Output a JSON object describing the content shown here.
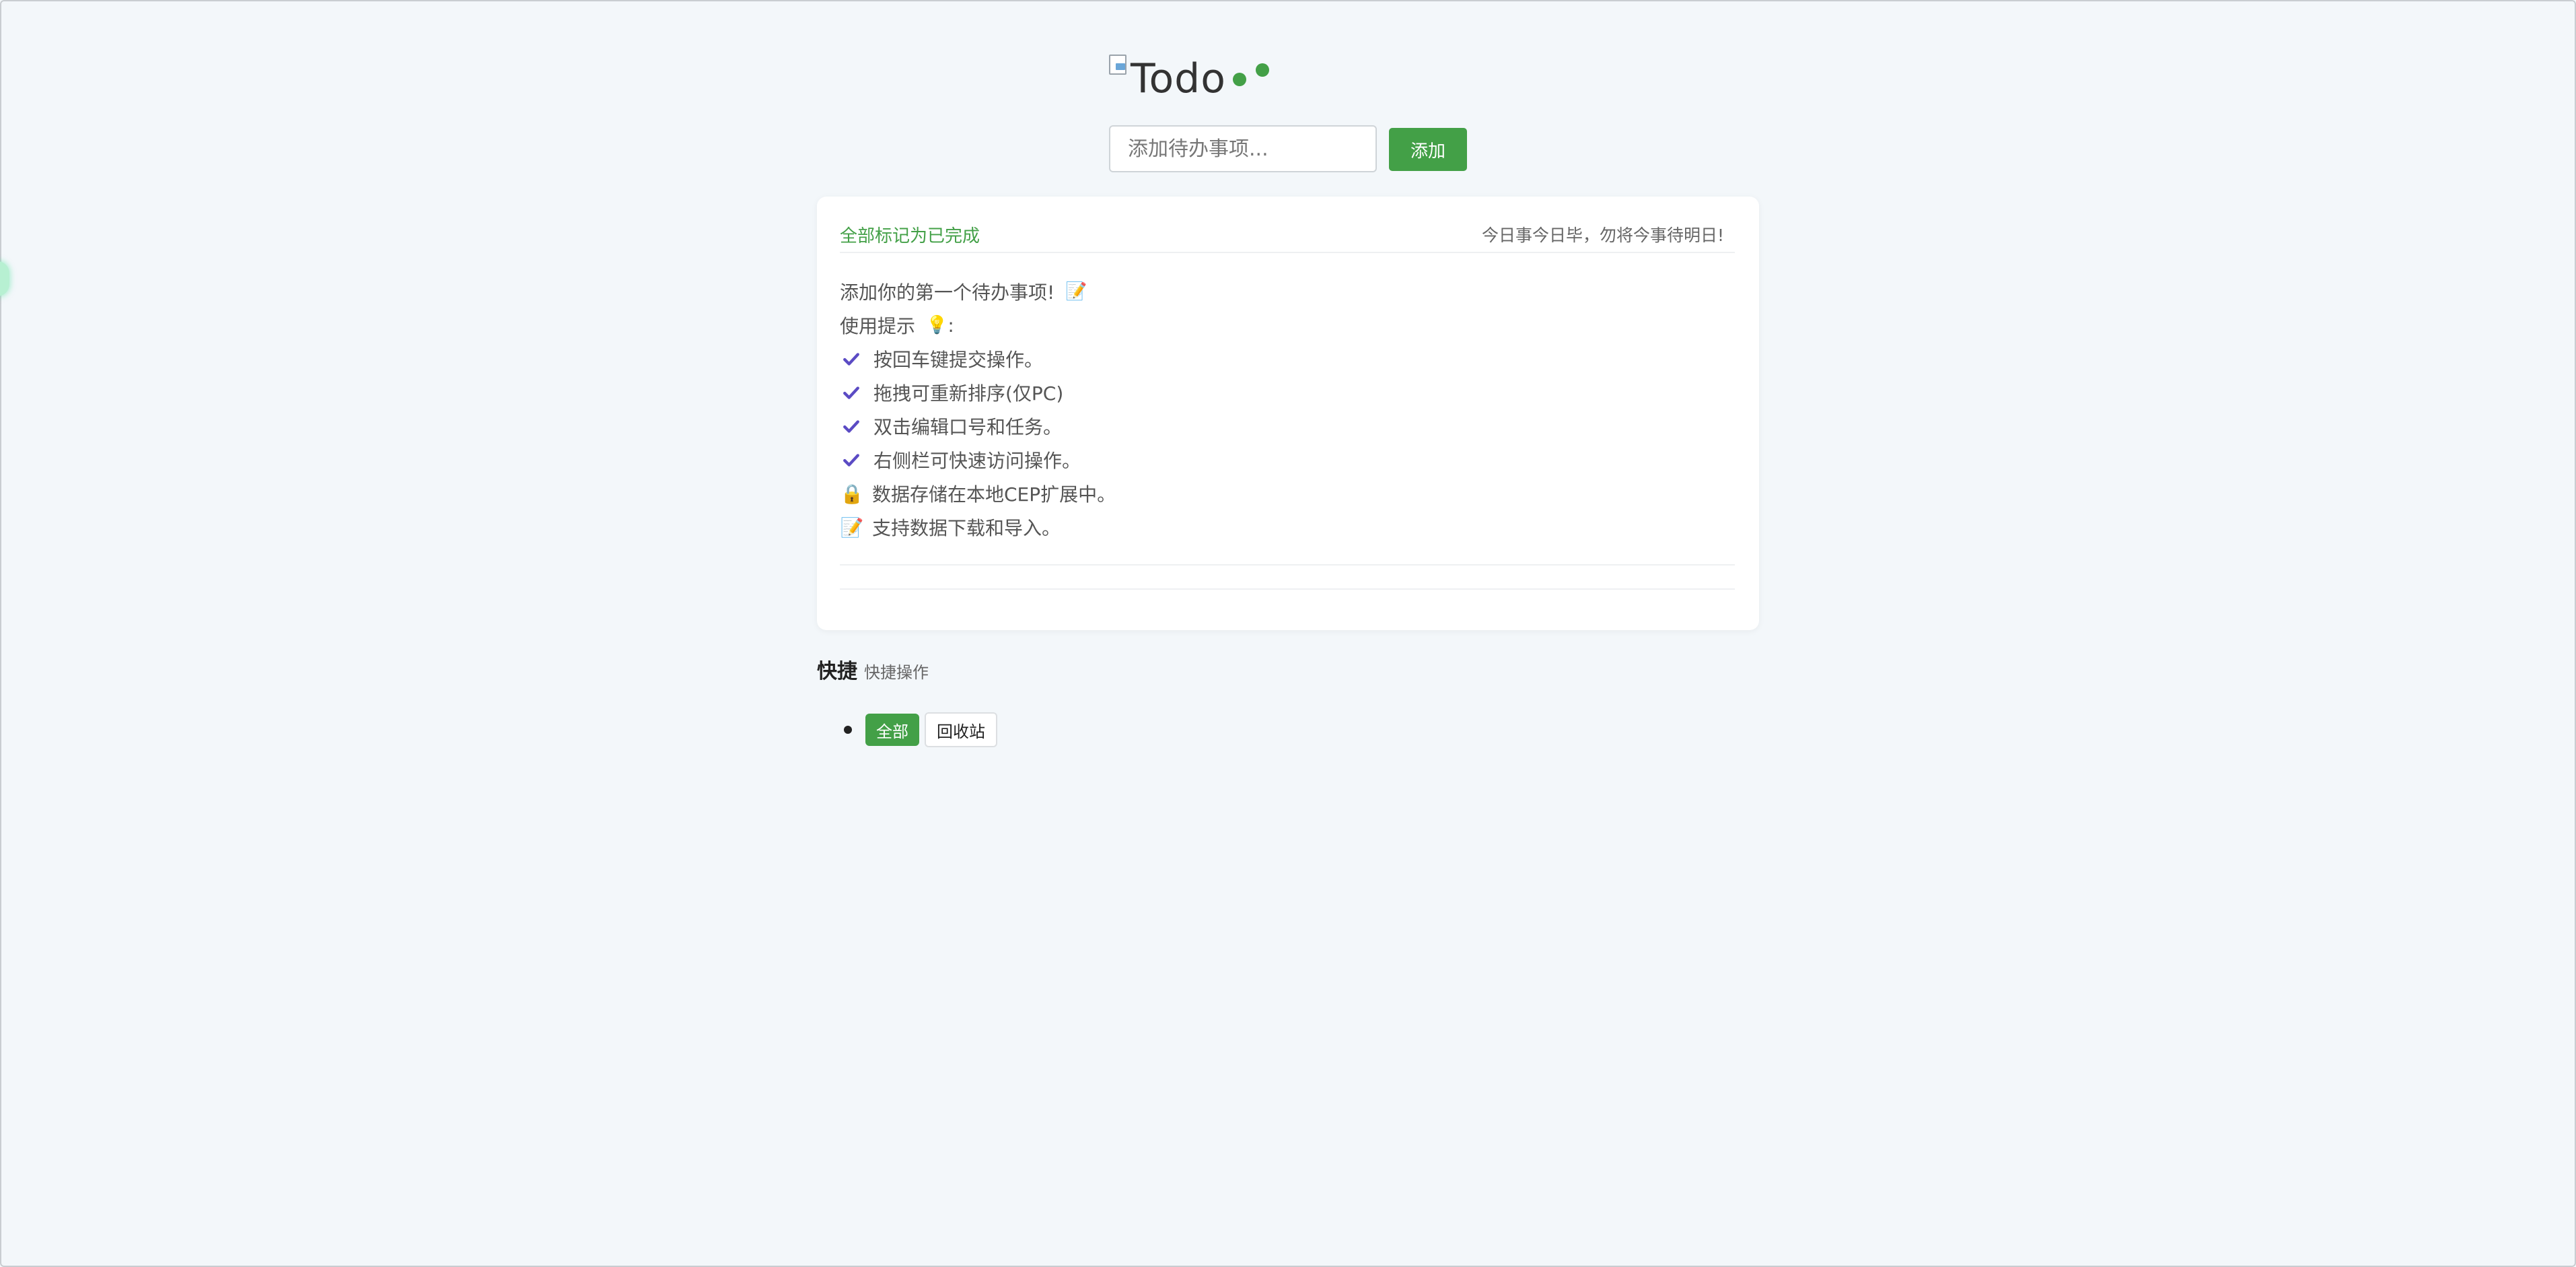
{
  "header": {
    "logo_alt": "Todo"
  },
  "add_form": {
    "placeholder": "添加待办事项...",
    "value": "",
    "add_label": "添加"
  },
  "card": {
    "mark_all_label": "全部标记为已完成",
    "motto": "今日事今日毕，勿将今事待明日!",
    "tips": {
      "intro": "添加你的第一个待办事项!",
      "intro_icon": "memo-icon",
      "title": "使用提示",
      "title_icon": "lightbulb-icon",
      "title_suffix": ":",
      "items": [
        {
          "icon": "check-icon",
          "text": "按回车键提交操作。"
        },
        {
          "icon": "check-icon",
          "text": "拖拽可重新排序(仅PC)"
        },
        {
          "icon": "check-icon",
          "text": "双击编辑口号和任务。"
        },
        {
          "icon": "check-icon",
          "text": "右侧栏可快速访问操作。"
        },
        {
          "icon": "lock-icon",
          "text": "数据存储在本地CEP扩展中。"
        },
        {
          "icon": "memo-icon",
          "text": "支持数据下载和导入。"
        }
      ]
    }
  },
  "quick": {
    "title": "快捷",
    "subtitle": "快捷操作",
    "filters": [
      {
        "label": "全部",
        "active": true
      },
      {
        "label": "回收站",
        "active": false
      }
    ]
  },
  "colors": {
    "accent": "#43a047",
    "check": "#5b4bc4",
    "background": "#f3f7fa"
  }
}
